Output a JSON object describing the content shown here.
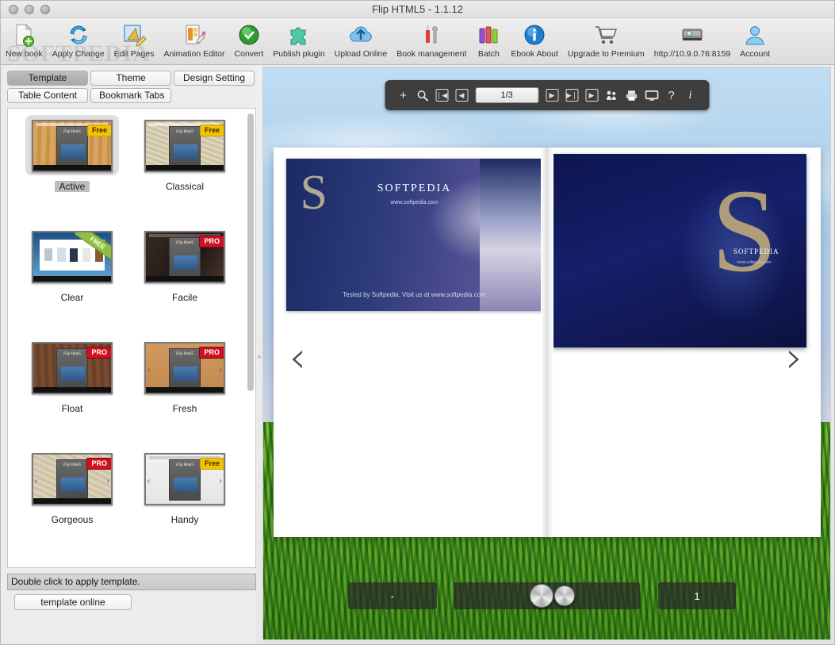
{
  "window": {
    "title": "Flip HTML5 - 1.1.12",
    "watermark": "SOFTPEDIA"
  },
  "toolbar": {
    "items": [
      {
        "label": "New book",
        "icon": "new-book-icon"
      },
      {
        "label": "Apply Change",
        "icon": "apply-change-icon"
      },
      {
        "label": "Edit Pages",
        "icon": "edit-pages-icon"
      },
      {
        "label": "Animation Editor",
        "icon": "animation-editor-icon"
      },
      {
        "label": "Convert",
        "icon": "convert-icon"
      },
      {
        "label": "Publish plugin",
        "icon": "publish-plugin-icon"
      },
      {
        "label": "Upload Online",
        "icon": "upload-online-icon"
      },
      {
        "label": "Book management",
        "icon": "book-management-icon"
      },
      {
        "label": "Batch",
        "icon": "batch-icon"
      },
      {
        "label": "Ebook About",
        "icon": "ebook-about-icon"
      },
      {
        "label": "Upgrade to Premium",
        "icon": "upgrade-premium-icon"
      },
      {
        "label": "http://10.9.0.76:8159",
        "icon": "server-icon"
      },
      {
        "label": "Account",
        "icon": "account-icon"
      }
    ]
  },
  "left_panel": {
    "tabs_row1": [
      "Template",
      "Theme",
      "Design Setting"
    ],
    "tabs_row2": [
      "Table Content",
      "Bookmark Tabs"
    ],
    "selected_tab": "Template",
    "templates": [
      {
        "name": "Active",
        "badge": "Free",
        "badge_style": "free",
        "selected": true
      },
      {
        "name": "Classical",
        "badge": "Free",
        "badge_style": "free",
        "selected": false
      },
      {
        "name": "Clear",
        "badge": "FREE",
        "badge_style": "diag",
        "selected": false
      },
      {
        "name": "Facile",
        "badge": "PRO",
        "badge_style": "pro",
        "selected": false
      },
      {
        "name": "Float",
        "badge": "PRO",
        "badge_style": "pro",
        "selected": false
      },
      {
        "name": "Fresh",
        "badge": "PRO",
        "badge_style": "pro",
        "selected": false
      },
      {
        "name": "Gorgeous",
        "badge": "PRO",
        "badge_style": "pro",
        "selected": false
      },
      {
        "name": "Handy",
        "badge": "Free",
        "badge_style": "free",
        "selected": false
      }
    ],
    "thumb_caption": "Flip Html5",
    "hint": "Double click to apply template.",
    "template_online_button": "template online"
  },
  "preview": {
    "toolbar": {
      "add": "+",
      "zoom": "search-icon",
      "first": "|◀",
      "prev": "◀",
      "page_field": "1/3",
      "next": "▶",
      "last": "▶|",
      "slideshow": "▶",
      "share": "share-icon",
      "print": "print-icon",
      "fullscreen": "monitor-icon",
      "help": "?",
      "info": "i"
    },
    "nav_prev": "‹",
    "nav_next": "›",
    "left_page": {
      "logo": "SOFTPEDIA",
      "url": "www.softpedia.com",
      "letter": "S",
      "footer": "Tested by Softpedia. Visit us at www.softpedia.com"
    },
    "right_page": {
      "letter": "S",
      "logo": "SOFTPEDIA",
      "url": "www.softpedia.com"
    },
    "bottom_bar": {
      "minus": "-",
      "slider": "",
      "page_number": "1"
    }
  }
}
